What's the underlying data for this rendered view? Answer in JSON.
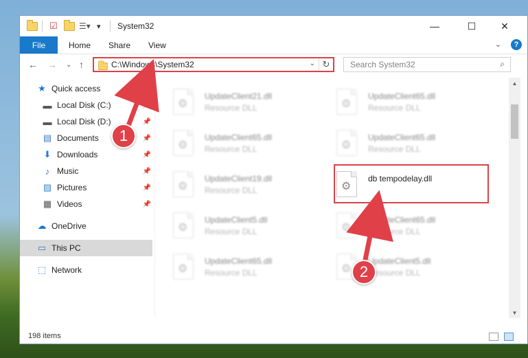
{
  "window": {
    "title": "System32",
    "controls": {
      "minimize": "—",
      "maximize": "☐",
      "close": "✕"
    }
  },
  "ribbon": {
    "file_tab": "File",
    "tabs": [
      "Home",
      "Share",
      "View"
    ],
    "help_icon": "?",
    "collapse_icon": "⌄"
  },
  "navigation": {
    "back": "←",
    "forward": "→",
    "recent": "⌄",
    "up": "↑",
    "address_path": "C:\\Windows\\System32",
    "address_dropdown": "⌄",
    "refresh": "↻",
    "search_placeholder": "Search System32",
    "search_icon": "⌕"
  },
  "sidebar": {
    "items": [
      {
        "label": "Quick access",
        "icon": "star-icon",
        "glyph": "★",
        "color": "#1979ca",
        "pinned": false,
        "selected": false
      },
      {
        "label": "Local Disk (C:)",
        "icon": "drive-icon",
        "glyph": "▬",
        "color": "#555555",
        "pinned": true,
        "selected": false
      },
      {
        "label": "Local Disk (D:)",
        "icon": "drive-icon",
        "glyph": "▬",
        "color": "#555555",
        "pinned": true,
        "selected": false
      },
      {
        "label": "Documents",
        "icon": "document-icon",
        "glyph": "▤",
        "color": "#3b78c4",
        "pinned": true,
        "selected": false
      },
      {
        "label": "Downloads",
        "icon": "download-icon",
        "glyph": "⬇",
        "color": "#2c7ad6",
        "pinned": true,
        "selected": false
      },
      {
        "label": "Music",
        "icon": "music-icon",
        "glyph": "♪",
        "color": "#2c7ad6",
        "pinned": true,
        "selected": false
      },
      {
        "label": "Pictures",
        "icon": "pictures-icon",
        "glyph": "▨",
        "color": "#3d88c8",
        "pinned": true,
        "selected": false
      },
      {
        "label": "Videos",
        "icon": "video-icon",
        "glyph": "▦",
        "color": "#555555",
        "pinned": true,
        "selected": false
      },
      {
        "label": "OneDrive",
        "icon": "cloud-icon",
        "glyph": "☁",
        "color": "#1979ca",
        "pinned": false,
        "selected": false
      },
      {
        "label": "This PC",
        "icon": "computer-icon",
        "glyph": "▭",
        "color": "#3b78c4",
        "pinned": false,
        "selected": true
      },
      {
        "label": "Network",
        "icon": "network-icon",
        "glyph": "⬚",
        "color": "#3b78c4",
        "pinned": false,
        "selected": false
      }
    ],
    "pin_glyph": "📌"
  },
  "files": [
    {
      "name": "UpdateClient21.dll",
      "type": "Resource DLL",
      "blurred": true
    },
    {
      "name": "UpdateClient65.dll",
      "type": "Resource DLL",
      "blurred": true
    },
    {
      "name": "UpdateClient65.dll",
      "type": "Resource DLL",
      "blurred": true
    },
    {
      "name": "UpdateClient65.dll",
      "type": "Resource DLL",
      "blurred": true
    },
    {
      "name": "UpdateClient19.dll",
      "type": "Resource DLL",
      "blurred": true
    },
    {
      "name": "db tempodelay.dll",
      "type": "",
      "blurred": false
    },
    {
      "name": "UpdateClient5.dll",
      "type": "Resource DLL",
      "blurred": true
    },
    {
      "name": "UpdateClient65.dll",
      "type": "Resource DLL",
      "blurred": true
    },
    {
      "name": "UpdateClient65.dll",
      "type": "Resource DLL",
      "blurred": true
    },
    {
      "name": "UpdateClient5.dll",
      "type": "Resource DLL",
      "blurred": true
    }
  ],
  "status": {
    "item_count": "198 items"
  },
  "callouts": [
    {
      "number": "1",
      "color": "#e04048"
    },
    {
      "number": "2",
      "color": "#e04048"
    }
  ],
  "colors": {
    "accent": "#1979ca",
    "highlight": "#d94348"
  }
}
